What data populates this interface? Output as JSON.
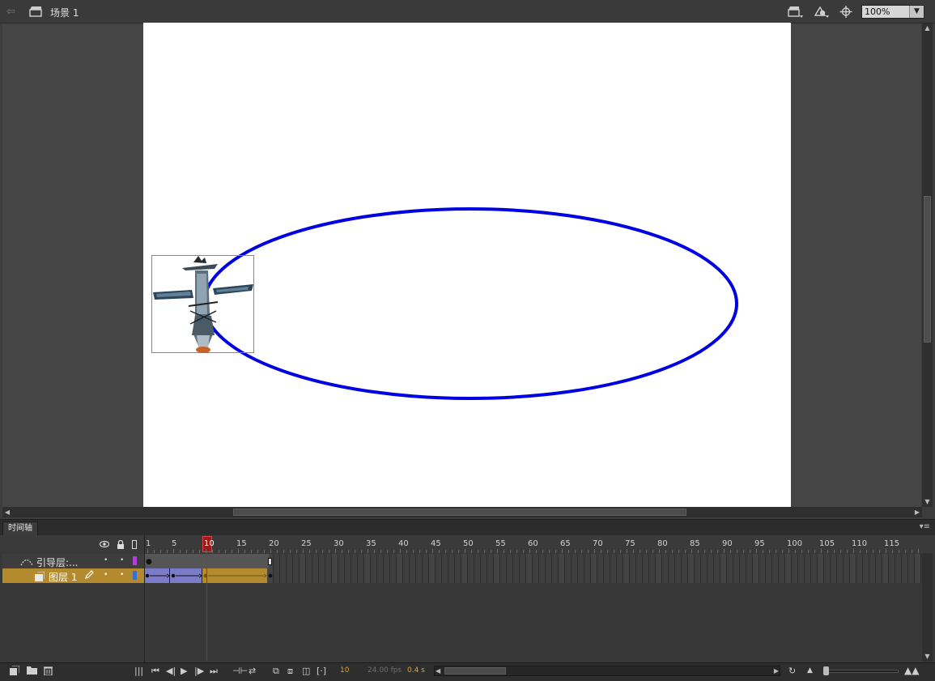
{
  "topbar": {
    "scene_label": "场景 1",
    "zoom_value": "100%"
  },
  "timeline": {
    "tab_label": "时间轴",
    "frame_numbers": [
      "1",
      "5",
      "10",
      "15",
      "20",
      "25",
      "30",
      "35",
      "40",
      "45",
      "50",
      "55",
      "60",
      "65",
      "70",
      "75",
      "80",
      "85",
      "90",
      "95",
      "100",
      "105",
      "110",
      "115"
    ],
    "current_frame": 10,
    "layers": [
      {
        "name": "引导层:...",
        "type": "guide",
        "color": "#b13fd6"
      },
      {
        "name": "图层 1",
        "type": "normal",
        "color": "#3a6fd8",
        "selected": true
      }
    ],
    "status": {
      "frame": "10",
      "fps": "24.00 fps",
      "time": "0.4 s"
    }
  },
  "stage": {
    "motion_path_color": "#0000e0",
    "bounding_box_color": "#19b3c6"
  },
  "colors": {
    "accent_selected_layer": "#b38a2e",
    "playhead": "#c02020"
  },
  "icons": {
    "back": "arrow-left-icon",
    "scene": "clapper-icon",
    "edit_scene": "clapper-dropdown-icon",
    "edit_symbol": "symbol-dropdown-icon",
    "center_stage": "crosshair-icon"
  }
}
